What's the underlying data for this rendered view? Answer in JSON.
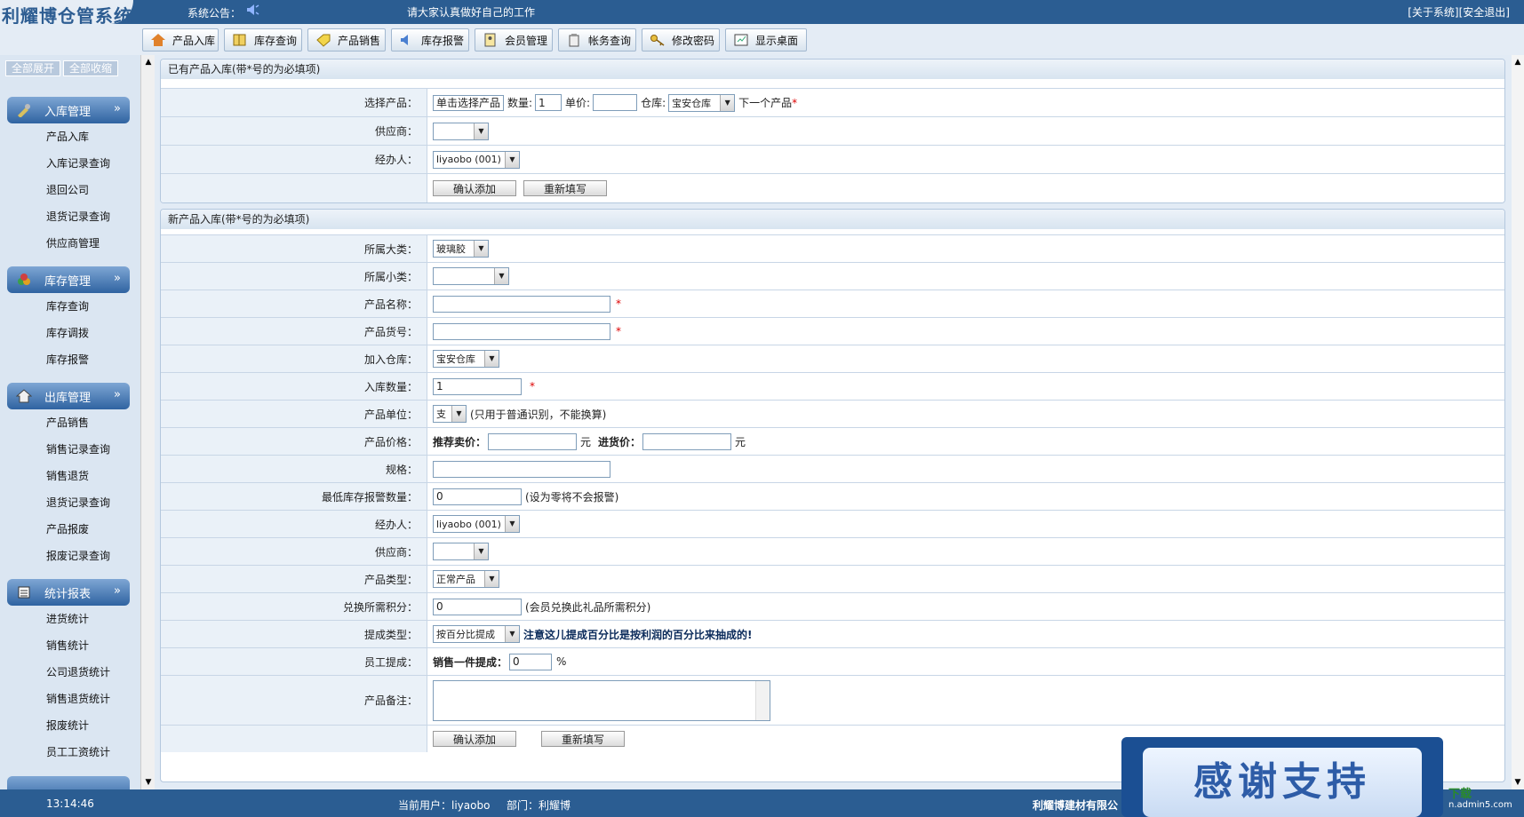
{
  "header": {
    "title": "利耀博仓管系统",
    "notice_label": "系统公告：",
    "notice_text": "请大家认真做好自己的工作",
    "about": "[关于系统]",
    "logout": "[安全退出]"
  },
  "toolbar": {
    "items": [
      {
        "label": "产品入库",
        "icon": "house-icon"
      },
      {
        "label": "库存查询",
        "icon": "book-icon"
      },
      {
        "label": "产品销售",
        "icon": "tag-icon"
      },
      {
        "label": "库存报警",
        "icon": "speaker-icon"
      },
      {
        "label": "会员管理",
        "icon": "member-card-icon"
      },
      {
        "label": "帐务查询",
        "icon": "ledger-icon"
      },
      {
        "label": "修改密码",
        "icon": "key-icon"
      },
      {
        "label": "显示桌面",
        "icon": "desktop-icon"
      }
    ]
  },
  "sidebar": {
    "expand_all": "全部展开",
    "collapse_all": "全部收缩",
    "groups": [
      {
        "title": "入库管理",
        "items": [
          "产品入库",
          "入库记录查询",
          "退回公司",
          "退货记录查询",
          "供应商管理"
        ]
      },
      {
        "title": "库存管理",
        "items": [
          "库存查询",
          "库存调拨",
          "库存报警"
        ]
      },
      {
        "title": "出库管理",
        "items": [
          "产品销售",
          "销售记录查询",
          "销售退货",
          "退货记录查询",
          "产品报废",
          "报废记录查询"
        ]
      },
      {
        "title": "统计报表",
        "items": [
          "进货统计",
          "销售统计",
          "公司退货统计",
          "销售退货统计",
          "报废统计",
          "员工工资统计"
        ]
      }
    ]
  },
  "existing": {
    "title": "已有产品入库(带*号的为必填项)",
    "select_label": "选择产品：",
    "select_btn": "单击选择产品",
    "qty_label": "数量:",
    "qty_value": "1",
    "price_label": "单价:",
    "price_value": "",
    "warehouse_label": "仓库:",
    "warehouse_value": "宝安仓库",
    "next_product": "下一个产品",
    "supplier_label": "供应商：",
    "supplier_value": "",
    "handler_label": "经办人：",
    "handler_value": "liyaobo (001)",
    "confirm": "确认添加",
    "reset": "重新填写"
  },
  "newproduct": {
    "title": "新产品入库(带*号的为必填项)",
    "category_label": "所属大类：",
    "category_value": "玻璃胶",
    "subcategory_label": "所属小类：",
    "subcategory_value": "",
    "name_label": "产品名称：",
    "name_value": "",
    "code_label": "产品货号：",
    "code_value": "",
    "warehouse_label": "加入仓库：",
    "warehouse_value": "宝安仓库",
    "qty_label": "入库数量：",
    "qty_value": "1",
    "unit_label": "产品单位：",
    "unit_value": "支",
    "unit_note": "(只用于普通识别，不能换算)",
    "price_label": "产品价格：",
    "retail_label": "推荐卖价：",
    "retail_value": "",
    "yuan1": "元",
    "cost_label": "进货价：",
    "cost_value": "",
    "yuan2": "元",
    "spec_label": "规格：",
    "spec_value": "",
    "min_stock_label": "最低库存报警数量：",
    "min_stock_value": "0",
    "min_stock_note": "(设为零将不会报警)",
    "handler_label": "经办人：",
    "handler_value": "liyaobo (001)",
    "supplier_label": "供应商：",
    "supplier_value": "",
    "type_label": "产品类型：",
    "type_value": "正常产品",
    "points_label": "兑换所需积分：",
    "points_value": "0",
    "points_note": "(会员兑换此礼品所需积分)",
    "commission_type_label": "提成类型：",
    "commission_type_value": "按百分比提成",
    "commission_note": "注意这儿提成百分比是按利润的百分比来抽成的!",
    "staff_commission_label": "员工提成：",
    "per_sale_label": "销售一件提成：",
    "per_sale_value": "0",
    "percent": "%",
    "remark_label": "产品备注：",
    "remark_value": "",
    "confirm": "确认添加",
    "reset": "重新填写"
  },
  "status": {
    "time": "13:14:46",
    "user": "当前用户：liyaobo",
    "dept": "部门：利耀博",
    "company": "利耀博建材有限公"
  },
  "overlay": {
    "thanks": "感谢支持",
    "site": "n.admin5.com",
    "site_logo": "下载"
  }
}
